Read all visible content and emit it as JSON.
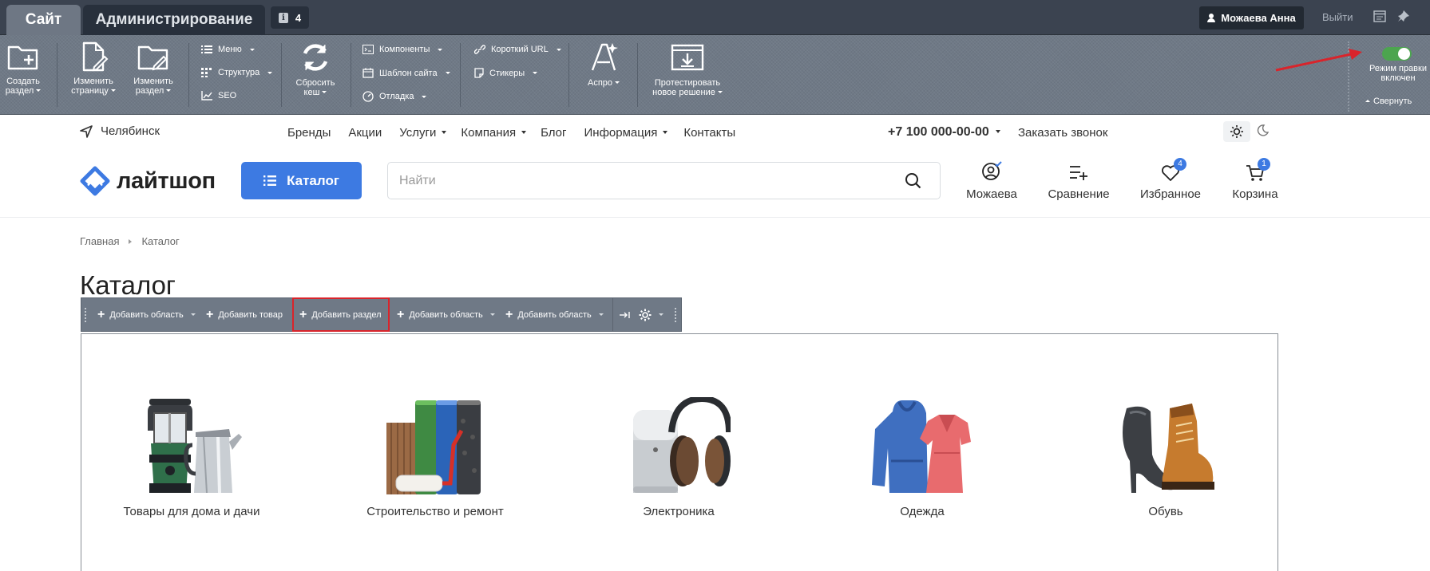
{
  "admin": {
    "tab_site": "Сайт",
    "tab_admin": "Администрирование",
    "notifications": "4",
    "user": "Можаева Анна",
    "logout": "Выйти"
  },
  "toolbar": {
    "create_section": "Создать\nраздел",
    "edit_page": "Изменить\nстраницу",
    "edit_section": "Изменить\nраздел",
    "menu": "Меню",
    "structure": "Структура",
    "seo": "SEO",
    "reset_cache": "Сбросить\nкеш",
    "components": "Компоненты",
    "site_template": "Шаблон сайта",
    "debug": "Отладка",
    "short_url": "Короткий URL",
    "stickers": "Стикеры",
    "aspro": "Аспро",
    "test_solution": "Протестировать\nновое решение",
    "edit_mode": "Режим правки\nвключен",
    "edit_mode_on": true,
    "collapse": "Свернуть"
  },
  "site": {
    "city": "Челябинск",
    "menu": [
      {
        "label": "Бренды",
        "dropdown": false
      },
      {
        "label": "Акции",
        "dropdown": false
      },
      {
        "label": "Услуги",
        "dropdown": true
      },
      {
        "label": "Компания",
        "dropdown": true
      },
      {
        "label": "Блог",
        "dropdown": false
      },
      {
        "label": "Информация",
        "dropdown": true
      },
      {
        "label": "Контакты",
        "dropdown": false
      }
    ],
    "phone": "+7 100 000-00-00",
    "callback": "Заказать звонок",
    "logo": "лайтшоп",
    "catalog_button": "Каталог",
    "search_placeholder": "Найти",
    "profile": "Можаева",
    "compare": "Сравнение",
    "favorites": "Избранное",
    "favorites_count": "4",
    "cart": "Корзина",
    "cart_count": "1",
    "accent": "#3d7ae2"
  },
  "breadcrumbs": [
    "Главная",
    "Каталог"
  ],
  "page_title": "Каталог",
  "component_bar": {
    "add_area_1": "Добавить область",
    "add_product": "Добавить товар",
    "add_section": "Добавить раздел",
    "add_area_2": "Добавить область",
    "add_area_3": "Добавить область"
  },
  "categories": [
    {
      "name": "Товары для дома и дачи",
      "icon": "lantern-and-kettle-icon"
    },
    {
      "name": "Строительство и ремонт",
      "icon": "wallpaper-rolls-icon"
    },
    {
      "name": "Электроника",
      "icon": "speaker-headphones-icon"
    },
    {
      "name": "Одежда",
      "icon": "hoodie-dress-icon"
    },
    {
      "name": "Обувь",
      "icon": "shoes-icon"
    }
  ]
}
